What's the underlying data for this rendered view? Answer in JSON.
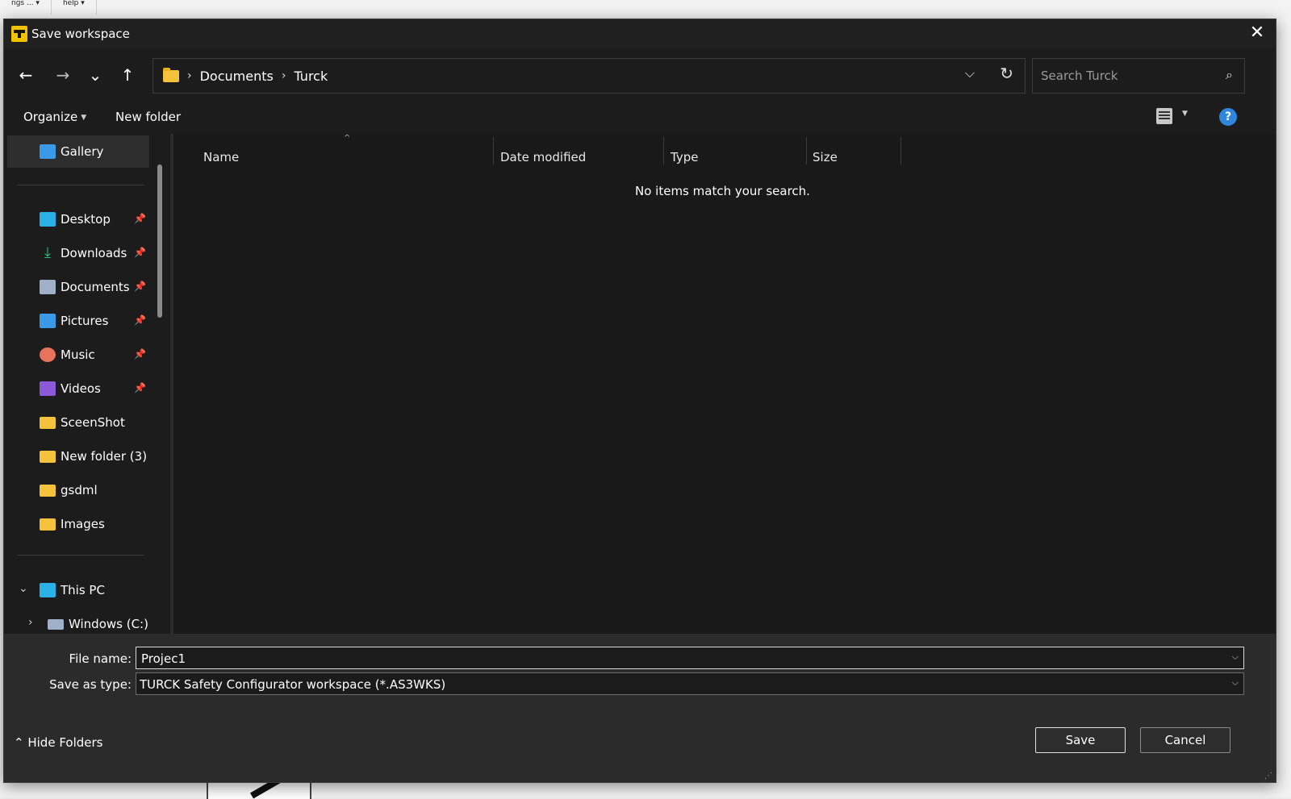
{
  "background": {
    "menu": [
      "ngs ... ▾",
      "help ▾"
    ]
  },
  "dialog": {
    "title": "Save workspace",
    "close_glyph": "✕"
  },
  "nav": {
    "back": "←",
    "forward": "→",
    "recent": "⌄",
    "up": "↑",
    "breadcrumbs": [
      "Documents",
      "Turck"
    ],
    "search_placeholder": "Search Turck"
  },
  "commands": {
    "organize": "Organize",
    "new_folder": "New folder",
    "help": "?"
  },
  "sidebar": {
    "gallery": "Gallery",
    "quick_access": [
      {
        "label": "Desktop",
        "icon": "desktop-icon",
        "color": "#2bb0e8",
        "pinned": true
      },
      {
        "label": "Downloads",
        "icon": "downloads-icon",
        "color": "#2fc18a",
        "pinned": true
      },
      {
        "label": "Documents",
        "icon": "documents-icon",
        "color": "#9fb0c8",
        "pinned": true
      },
      {
        "label": "Pictures",
        "icon": "pictures-icon",
        "color": "#3a9ae8",
        "pinned": true
      },
      {
        "label": "Music",
        "icon": "music-icon",
        "color": "#e8735a",
        "pinned": true
      },
      {
        "label": "Videos",
        "icon": "videos-icon",
        "color": "#8c5ad8",
        "pinned": true
      },
      {
        "label": "SceenShot",
        "icon": "folder-icon",
        "color": "#f5c33b",
        "pinned": false
      },
      {
        "label": "New folder (3)",
        "icon": "folder-icon",
        "color": "#f5c33b",
        "pinned": false
      },
      {
        "label": "gsdml",
        "icon": "folder-icon",
        "color": "#f5c33b",
        "pinned": false
      },
      {
        "label": "Images",
        "icon": "folder-icon",
        "color": "#f5c33b",
        "pinned": false
      }
    ],
    "this_pc": "This PC",
    "drive": "Windows (C:)"
  },
  "columns": [
    "Name",
    "Date modified",
    "Type",
    "Size"
  ],
  "empty_message": "No items match your search.",
  "form": {
    "file_name_label": "File name:",
    "file_name_value": "Projec1",
    "save_type_label": "Save as type:",
    "save_type_value": "TURCK Safety Configurator workspace (*.AS3WKS)"
  },
  "footer": {
    "hide_folders": "Hide Folders",
    "save": "Save",
    "cancel": "Cancel"
  }
}
